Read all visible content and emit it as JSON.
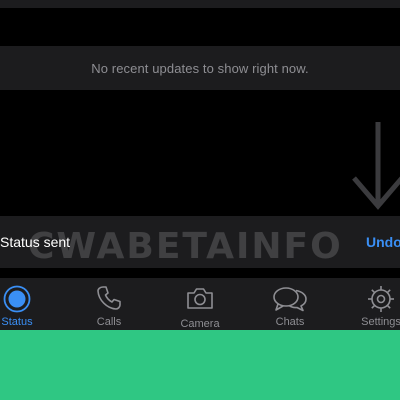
{
  "status_screen": {
    "empty_message": "No recent updates to show right now."
  },
  "toast": {
    "message": "Status sent",
    "action": "Undo"
  },
  "watermark": {
    "text": "CWABETAINFO"
  },
  "tabbar": {
    "tabs": [
      {
        "label": "Status",
        "icon": "status-icon",
        "active": true
      },
      {
        "label": "Calls",
        "icon": "phone-icon",
        "active": false
      },
      {
        "label": "Camera",
        "icon": "camera-icon",
        "active": false
      },
      {
        "label": "Chats",
        "icon": "chat-bubbles-icon",
        "active": false
      },
      {
        "label": "Settings",
        "icon": "gear-icon",
        "active": false
      }
    ]
  },
  "colors": {
    "background": "#000000",
    "surface": "#1c1c1e",
    "accent": "#3a8ff5",
    "inactive": "#8e8e93",
    "bottom_panel": "#2fc783"
  }
}
